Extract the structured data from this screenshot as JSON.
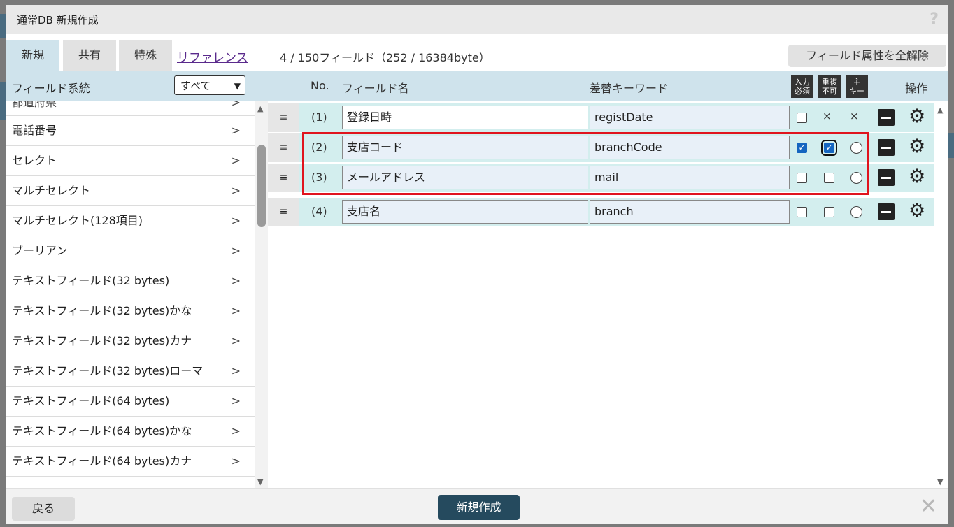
{
  "dialog": {
    "title": "通常DB 新規作成",
    "help": "?"
  },
  "tabs": [
    {
      "label": "新規",
      "active": true
    },
    {
      "label": "共有",
      "active": false
    },
    {
      "label": "特殊",
      "active": false
    }
  ],
  "reference_link": "リファレンス",
  "field_count": "4 / 150フィールド（252 / 16384byte）",
  "clear_button": "フィールド属性を全解除",
  "left_panel": {
    "header": "フィールド系統",
    "select_value": "すべて",
    "items": [
      "都道府県",
      "電話番号",
      "セレクト",
      "マルチセレクト",
      "マルチセレクト(128項目)",
      "ブーリアン",
      "テキストフィールド(32 bytes)",
      "テキストフィールド(32 bytes)かな",
      "テキストフィールド(32 bytes)カナ",
      "テキストフィールド(32 bytes)ローマ",
      "テキストフィールド(64 bytes)",
      "テキストフィールド(64 bytes)かな",
      "テキストフィールド(64 bytes)カナ"
    ],
    "arrow": ">"
  },
  "grid": {
    "headers": {
      "no": "No.",
      "field_name": "フィールド名",
      "keyword": "差替キーワード",
      "required": "入力\n必須",
      "unique": "重複\n不可",
      "primary": "主\nキー",
      "ops": "操作"
    },
    "handle": "≡",
    "rows": [
      {
        "no": "(1)",
        "name": "登録日時",
        "keyword": "registDate",
        "required": false,
        "unique": "×",
        "primary": "×"
      },
      {
        "no": "(2)",
        "name": "支店コード",
        "keyword": "branchCode",
        "required": true,
        "unique": true,
        "primary": "radio"
      },
      {
        "no": "(3)",
        "name": "メールアドレス",
        "keyword": "mail",
        "required": false,
        "unique": false,
        "primary": "radio"
      },
      {
        "no": "(4)",
        "name": "支店名",
        "keyword": "branch",
        "required": false,
        "unique": false,
        "primary": "radio"
      }
    ]
  },
  "footer": {
    "back": "戻る",
    "create": "新規作成"
  }
}
